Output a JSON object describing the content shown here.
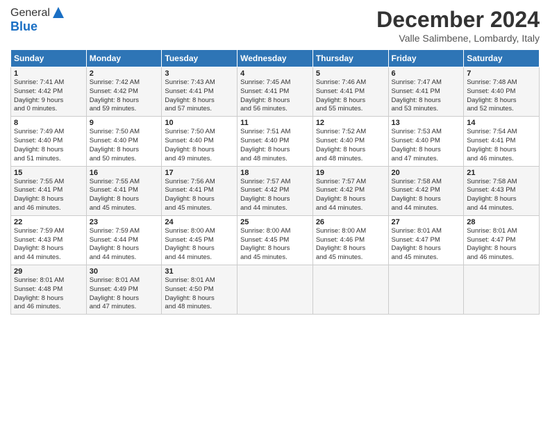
{
  "header": {
    "logo_line1": "General",
    "logo_line2": "Blue",
    "month_title": "December 2024",
    "location": "Valle Salimbene, Lombardy, Italy"
  },
  "days_of_week": [
    "Sunday",
    "Monday",
    "Tuesday",
    "Wednesday",
    "Thursday",
    "Friday",
    "Saturday"
  ],
  "weeks": [
    [
      {
        "day": "1",
        "sunrise": "7:41 AM",
        "sunset": "4:42 PM",
        "daylight": "9 hours and 0 minutes."
      },
      {
        "day": "2",
        "sunrise": "7:42 AM",
        "sunset": "4:42 PM",
        "daylight": "8 hours and 59 minutes."
      },
      {
        "day": "3",
        "sunrise": "7:43 AM",
        "sunset": "4:41 PM",
        "daylight": "8 hours and 57 minutes."
      },
      {
        "day": "4",
        "sunrise": "7:45 AM",
        "sunset": "4:41 PM",
        "daylight": "8 hours and 56 minutes."
      },
      {
        "day": "5",
        "sunrise": "7:46 AM",
        "sunset": "4:41 PM",
        "daylight": "8 hours and 55 minutes."
      },
      {
        "day": "6",
        "sunrise": "7:47 AM",
        "sunset": "4:41 PM",
        "daylight": "8 hours and 53 minutes."
      },
      {
        "day": "7",
        "sunrise": "7:48 AM",
        "sunset": "4:40 PM",
        "daylight": "8 hours and 52 minutes."
      }
    ],
    [
      {
        "day": "8",
        "sunrise": "7:49 AM",
        "sunset": "4:40 PM",
        "daylight": "8 hours and 51 minutes."
      },
      {
        "day": "9",
        "sunrise": "7:50 AM",
        "sunset": "4:40 PM",
        "daylight": "8 hours and 50 minutes."
      },
      {
        "day": "10",
        "sunrise": "7:50 AM",
        "sunset": "4:40 PM",
        "daylight": "8 hours and 49 minutes."
      },
      {
        "day": "11",
        "sunrise": "7:51 AM",
        "sunset": "4:40 PM",
        "daylight": "8 hours and 48 minutes."
      },
      {
        "day": "12",
        "sunrise": "7:52 AM",
        "sunset": "4:40 PM",
        "daylight": "8 hours and 48 minutes."
      },
      {
        "day": "13",
        "sunrise": "7:53 AM",
        "sunset": "4:40 PM",
        "daylight": "8 hours and 47 minutes."
      },
      {
        "day": "14",
        "sunrise": "7:54 AM",
        "sunset": "4:41 PM",
        "daylight": "8 hours and 46 minutes."
      }
    ],
    [
      {
        "day": "15",
        "sunrise": "7:55 AM",
        "sunset": "4:41 PM",
        "daylight": "8 hours and 46 minutes."
      },
      {
        "day": "16",
        "sunrise": "7:55 AM",
        "sunset": "4:41 PM",
        "daylight": "8 hours and 45 minutes."
      },
      {
        "day": "17",
        "sunrise": "7:56 AM",
        "sunset": "4:41 PM",
        "daylight": "8 hours and 45 minutes."
      },
      {
        "day": "18",
        "sunrise": "7:57 AM",
        "sunset": "4:42 PM",
        "daylight": "8 hours and 44 minutes."
      },
      {
        "day": "19",
        "sunrise": "7:57 AM",
        "sunset": "4:42 PM",
        "daylight": "8 hours and 44 minutes."
      },
      {
        "day": "20",
        "sunrise": "7:58 AM",
        "sunset": "4:42 PM",
        "daylight": "8 hours and 44 minutes."
      },
      {
        "day": "21",
        "sunrise": "7:58 AM",
        "sunset": "4:43 PM",
        "daylight": "8 hours and 44 minutes."
      }
    ],
    [
      {
        "day": "22",
        "sunrise": "7:59 AM",
        "sunset": "4:43 PM",
        "daylight": "8 hours and 44 minutes."
      },
      {
        "day": "23",
        "sunrise": "7:59 AM",
        "sunset": "4:44 PM",
        "daylight": "8 hours and 44 minutes."
      },
      {
        "day": "24",
        "sunrise": "8:00 AM",
        "sunset": "4:45 PM",
        "daylight": "8 hours and 44 minutes."
      },
      {
        "day": "25",
        "sunrise": "8:00 AM",
        "sunset": "4:45 PM",
        "daylight": "8 hours and 45 minutes."
      },
      {
        "day": "26",
        "sunrise": "8:00 AM",
        "sunset": "4:46 PM",
        "daylight": "8 hours and 45 minutes."
      },
      {
        "day": "27",
        "sunrise": "8:01 AM",
        "sunset": "4:47 PM",
        "daylight": "8 hours and 45 minutes."
      },
      {
        "day": "28",
        "sunrise": "8:01 AM",
        "sunset": "4:47 PM",
        "daylight": "8 hours and 46 minutes."
      }
    ],
    [
      {
        "day": "29",
        "sunrise": "8:01 AM",
        "sunset": "4:48 PM",
        "daylight": "8 hours and 46 minutes."
      },
      {
        "day": "30",
        "sunrise": "8:01 AM",
        "sunset": "4:49 PM",
        "daylight": "8 hours and 47 minutes."
      },
      {
        "day": "31",
        "sunrise": "8:01 AM",
        "sunset": "4:50 PM",
        "daylight": "8 hours and 48 minutes."
      },
      null,
      null,
      null,
      null
    ]
  ]
}
